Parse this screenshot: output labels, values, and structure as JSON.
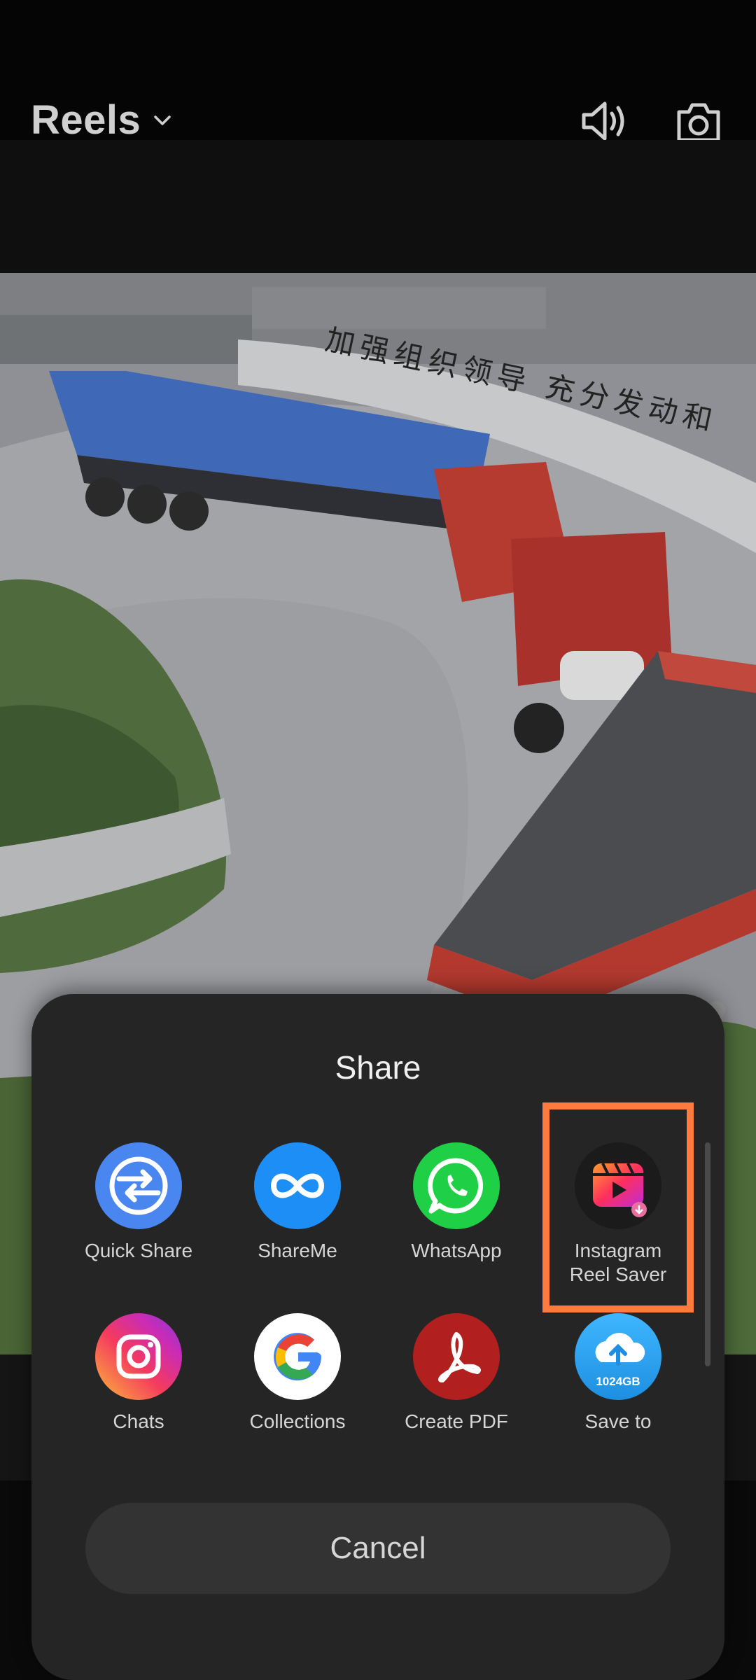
{
  "header": {
    "title": "Reels",
    "title_menu_icon": "chevron-down-icon",
    "sound_icon": "speaker-icon",
    "camera_icon": "camera-icon"
  },
  "video": {
    "overlay_text": "加强组织领导 充分发动和"
  },
  "share_sheet": {
    "title": "Share",
    "apps_row1": [
      {
        "label": "Quick Share",
        "icon": "quick-share-icon",
        "color": "#4a86f0"
      },
      {
        "label": "ShareMe",
        "icon": "shareme-icon",
        "color": "#1c8ef5"
      },
      {
        "label": "WhatsApp",
        "icon": "whatsapp-icon",
        "color": "#1fcf45"
      },
      {
        "label": "Instagram\nReel Saver",
        "icon": "reel-saver-icon",
        "color": "#ff3d3d"
      }
    ],
    "apps_row2": [
      {
        "label": "Chats",
        "icon": "instagram-icon"
      },
      {
        "label": "Collections",
        "icon": "google-icon"
      },
      {
        "label": "Create PDF",
        "icon": "acrobat-icon",
        "color": "#b11f1f"
      },
      {
        "label": "Save to",
        "icon": "cloud-upload-icon",
        "badge": "1024GB",
        "color": "#27a8f0"
      }
    ],
    "cancel_label": "Cancel",
    "highlight_color": "#ff7a3d"
  }
}
